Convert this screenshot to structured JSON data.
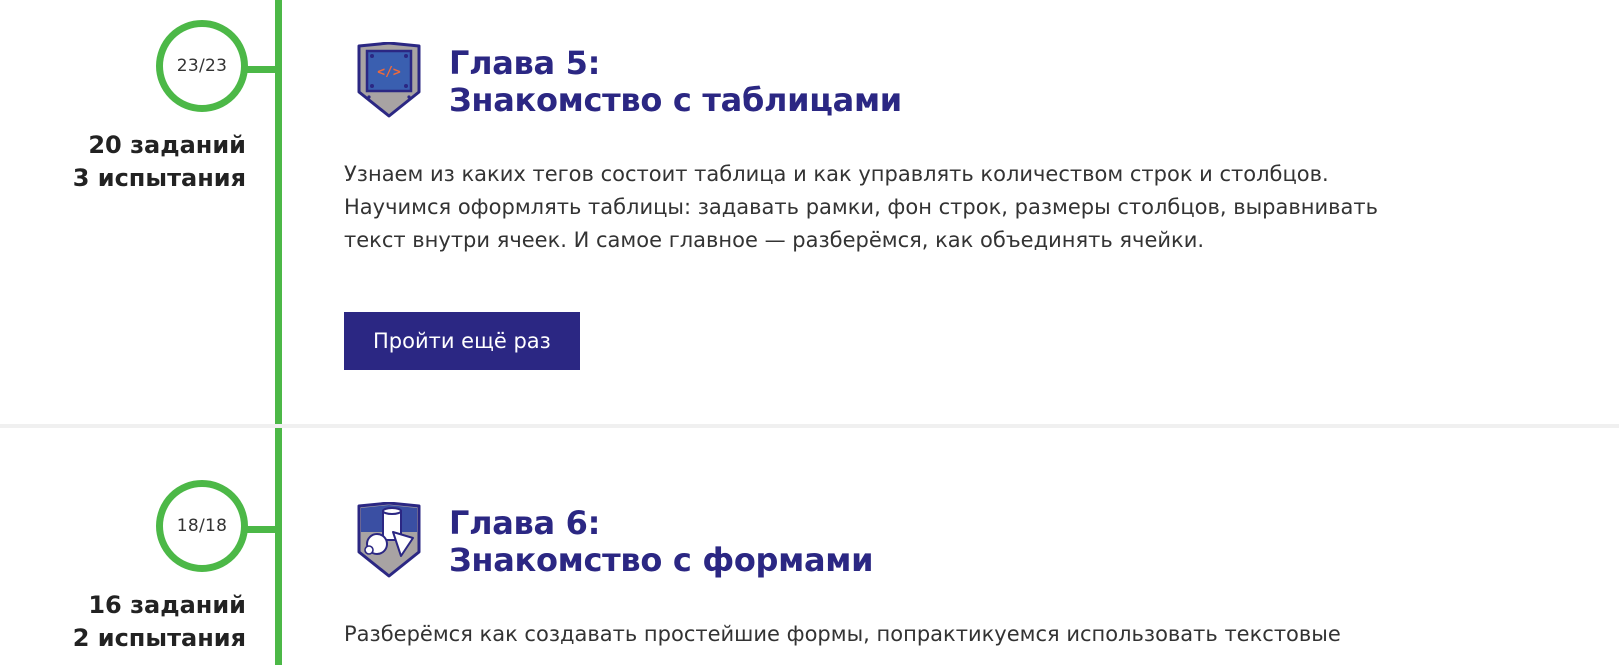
{
  "chapters": [
    {
      "progress": "23/23",
      "stats": [
        "20 заданий",
        "3 испытания"
      ],
      "icon": "code-board-badge-icon",
      "title_line1": "Глава 5:",
      "title_line2": "Знакомство с таблицами",
      "description_lines": [
        "Узнаем из каких тегов состоит таблица и как управлять количеством строк и столбцов.",
        "Научимся оформлять таблицы: задавать рамки, фон строк, размеры столбцов, выравнивать",
        "текст внутри ячеек. И самое главное — разберёмся, как объединять ячейки."
      ],
      "button_label": "Пройти ещё раз"
    },
    {
      "progress": "18/18",
      "stats": [
        "16 заданий",
        "2 испытания"
      ],
      "icon": "shapes-badge-icon",
      "title_line1": "Глава 6:",
      "title_line2": "Знакомство с формами",
      "description_lines": [
        "Разберёмся как создавать простейшие формы, попрактикуемся использовать текстовые"
      ]
    }
  ],
  "colors": {
    "accent_green": "#4cb847",
    "brand_purple": "#2b2783",
    "text": "#333333",
    "divider": "#f0f0f0"
  }
}
